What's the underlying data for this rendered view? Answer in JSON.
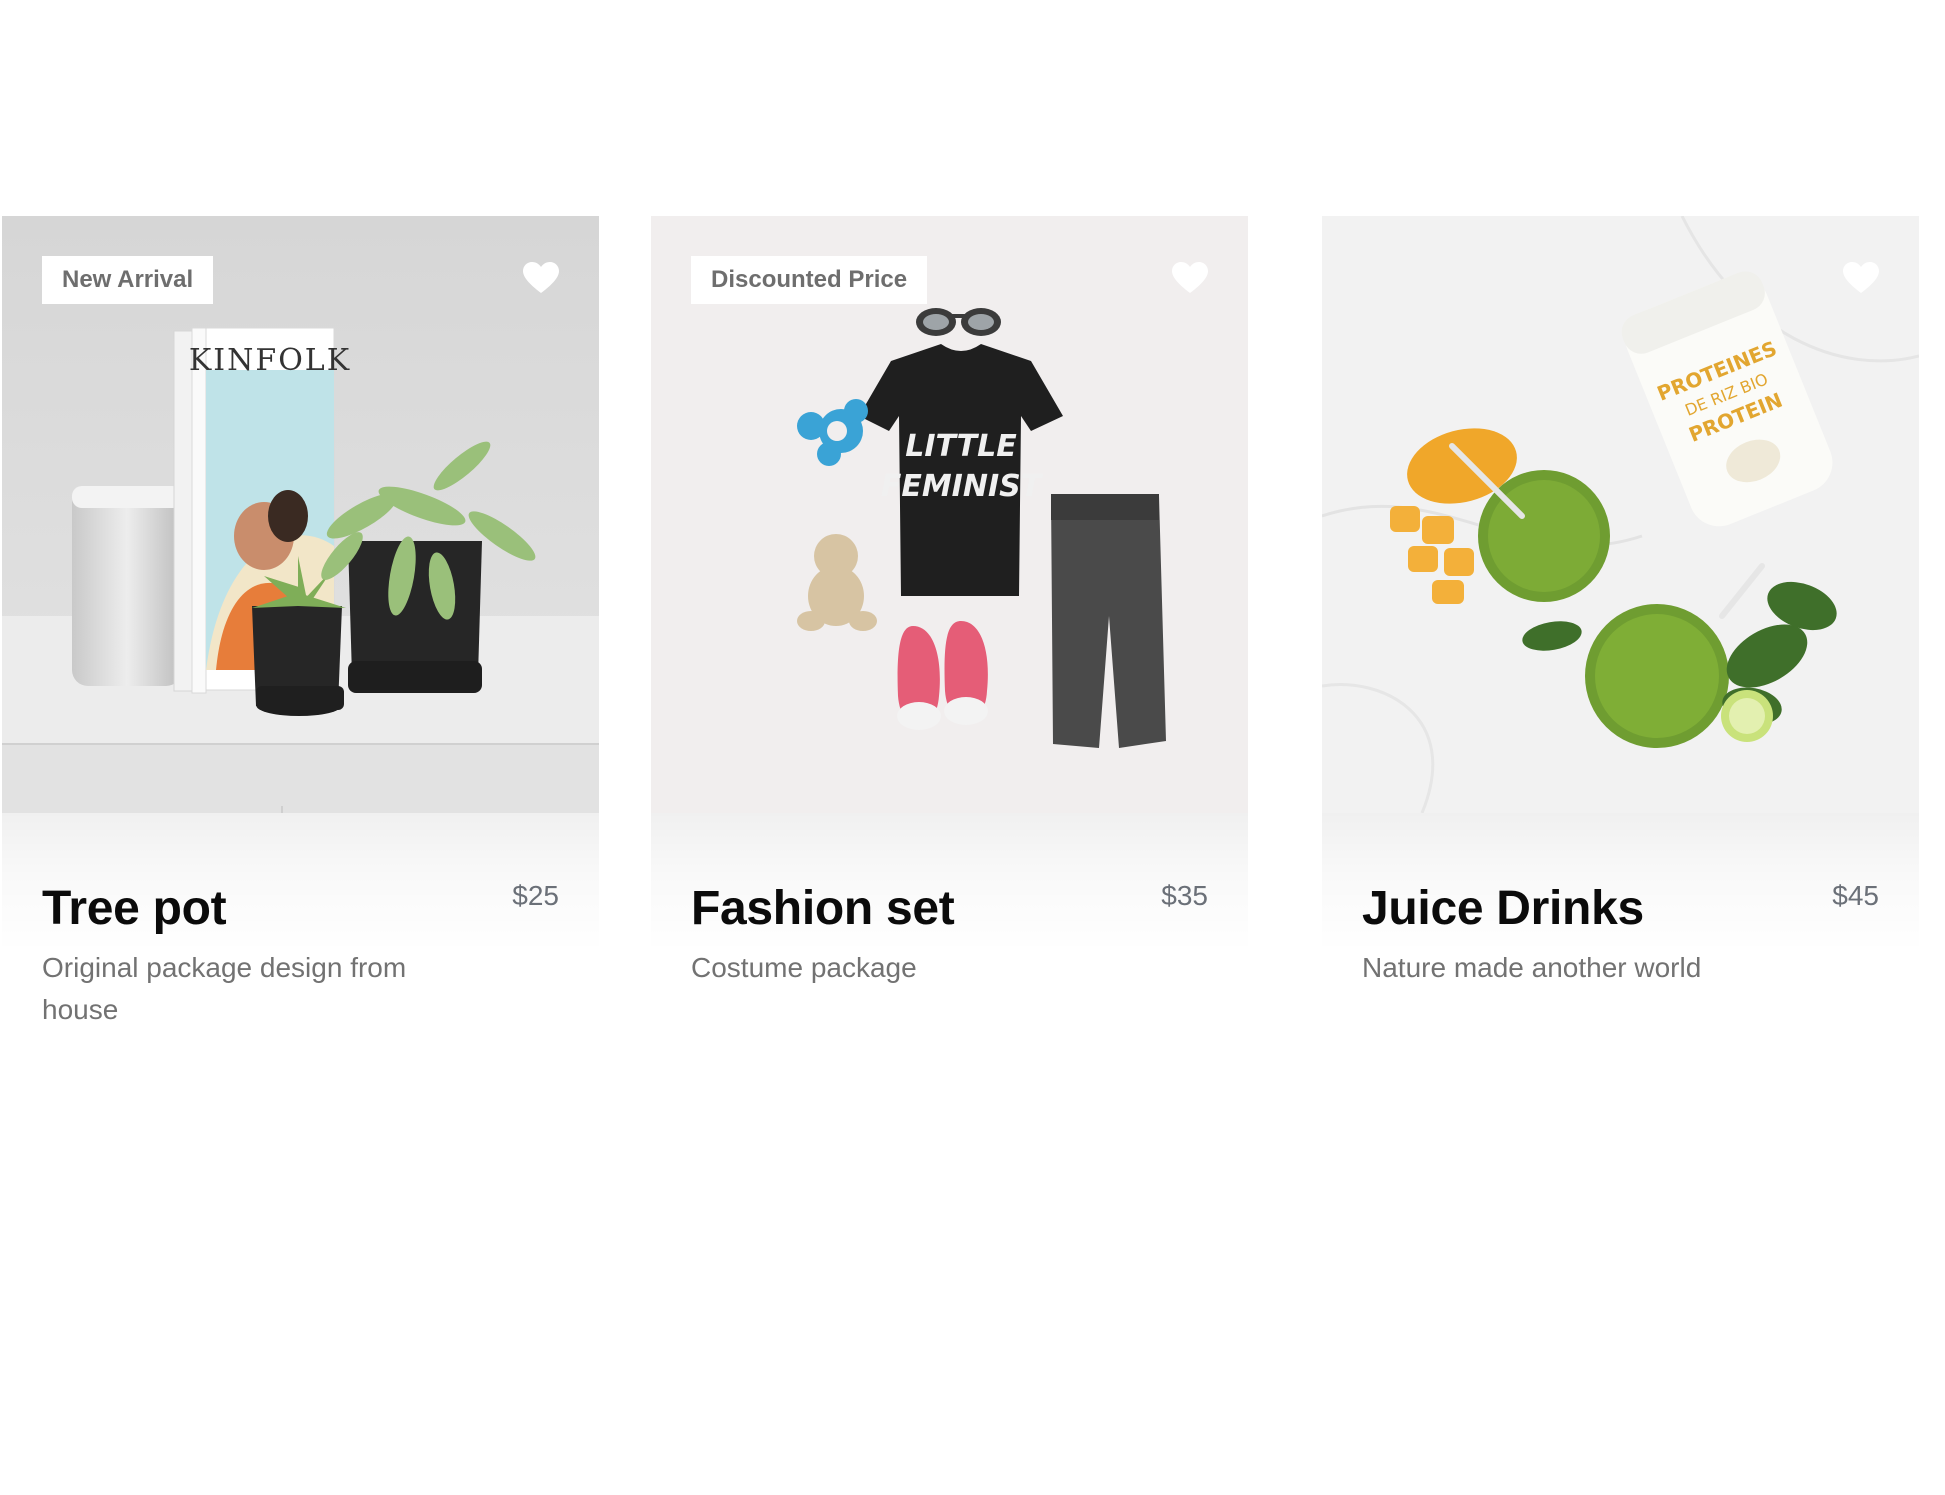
{
  "products": [
    {
      "badge": "New Arrival",
      "title": "Tree pot",
      "price": "$25",
      "description": "Original package design from house",
      "image_subject": "plant-pots-and-books-photo",
      "magazine_text": "KINFOLK",
      "favorite_icon": "heart-icon"
    },
    {
      "badge": "Discounted Price",
      "title": "Fashion set",
      "price": "$35",
      "description": "Costume package",
      "image_subject": "kids-outfit-flatlay-photo",
      "shirt_text_line1": "LITTLE",
      "shirt_text_line2": "FEMINIST",
      "favorite_icon": "heart-icon"
    },
    {
      "badge": "",
      "title": "Juice Drinks",
      "price": "$45",
      "description": "Nature made another world",
      "image_subject": "green-smoothies-photo",
      "jar_text_line1": "PROTEINES",
      "jar_text_line2": "DE RIZ BIO",
      "jar_text_line3": "PROTEIN",
      "favorite_icon": "heart-icon"
    }
  ],
  "colors": {
    "badge_text": "#6e6e6e",
    "title": "#0b0b0b",
    "price": "#6b7078",
    "description": "#727272",
    "heart": "#ffffff"
  }
}
